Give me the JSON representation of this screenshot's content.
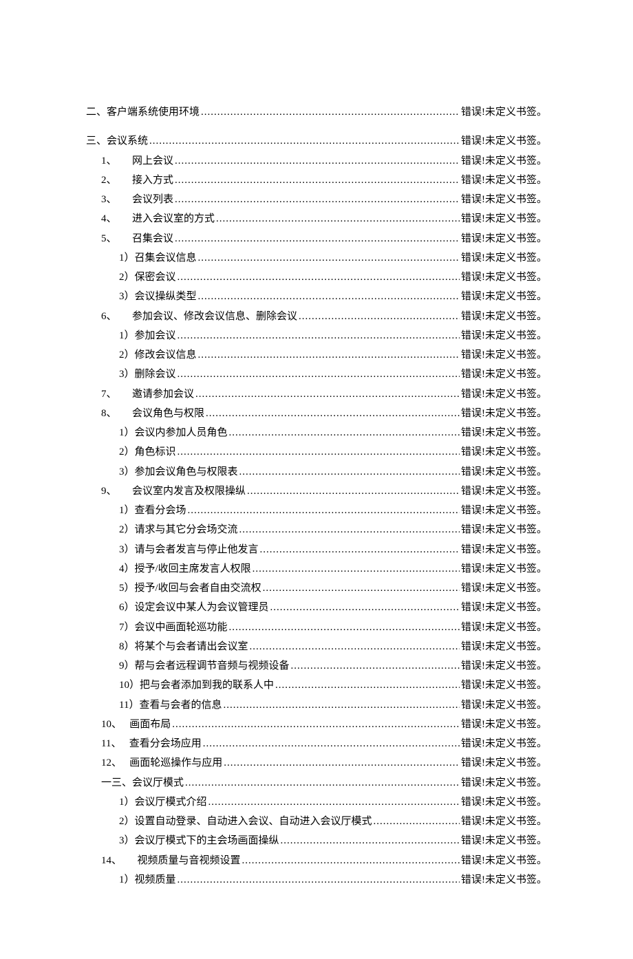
{
  "ref": "错误!未定义书签。",
  "toc": [
    {
      "label": "二、客户端系统使用环境",
      "indent": 0,
      "space": false
    },
    {
      "label": "三、会议系统",
      "indent": 0,
      "space": true
    },
    {
      "label": "1、　　网上会议 ",
      "indent": 1,
      "space": false
    },
    {
      "label": "2、　　接入方式 ",
      "indent": 1,
      "space": false
    },
    {
      "label": "3、　　会议列表 ",
      "indent": 1,
      "space": false
    },
    {
      "label": "4、　　进入会议室的方式 ",
      "indent": 1,
      "space": false
    },
    {
      "label": "5、　　召集会议 ",
      "indent": 1,
      "space": false
    },
    {
      "label": "1）召集会议信息",
      "indent": 2,
      "space": false
    },
    {
      "label": "2）保密会议",
      "indent": 2,
      "space": false
    },
    {
      "label": "3）会议操纵类型",
      "indent": 2,
      "space": false
    },
    {
      "label": "6、　　参加会议、修改会议信息、删除会议 ",
      "indent": 1,
      "space": false
    },
    {
      "label": "1）参加会议",
      "indent": 2,
      "space": false
    },
    {
      "label": "2）修改会议信息",
      "indent": 2,
      "space": false
    },
    {
      "label": "3）删除会议",
      "indent": 2,
      "space": false
    },
    {
      "label": "7、　　邀请参加会议 ",
      "indent": 1,
      "space": false
    },
    {
      "label": "8、　　会议角色与权限 ",
      "indent": 1,
      "space": false
    },
    {
      "label": "1）会议内参加人员角色",
      "indent": 2,
      "space": false
    },
    {
      "label": "2）角色标识",
      "indent": 2,
      "space": false
    },
    {
      "label": "3）参加会议角色与权限表",
      "indent": 2,
      "space": false
    },
    {
      "label": "9、　　会议室内发言及权限操纵 ",
      "indent": 1,
      "space": false
    },
    {
      "label": "1）查看分会场",
      "indent": 2,
      "space": false
    },
    {
      "label": "2）请求与其它分会场交流",
      "indent": 2,
      "space": false
    },
    {
      "label": "3）请与会者发言与停止他发言",
      "indent": 2,
      "space": false
    },
    {
      "label": "4）授予/收回主席发言人权限",
      "indent": 2,
      "space": false
    },
    {
      "label": "5）授予/收回与会者自由交流权",
      "indent": 2,
      "space": false
    },
    {
      "label": "6）设定会议中某人为会议管理员",
      "indent": 2,
      "space": false
    },
    {
      "label": "7）会议中画面轮巡功能",
      "indent": 2,
      "space": false
    },
    {
      "label": "8）将某个与会者请出会议室",
      "indent": 2,
      "space": false
    },
    {
      "label": "9）帮与会者远程调节音频与视频设备",
      "indent": 2,
      "space": false
    },
    {
      "label": "10）把与会者添加到我的联系人中",
      "indent": 2,
      "space": false
    },
    {
      "label": "11）查看与会者的信息",
      "indent": 2,
      "space": false
    },
    {
      "label": "10、　 画面布局 ",
      "indent": 1,
      "space": false
    },
    {
      "label": "11、　 查看分会场应用 ",
      "indent": 1,
      "space": false
    },
    {
      "label": "12、　 画面轮巡操作与应用 ",
      "indent": 1,
      "space": false
    },
    {
      "label": "一三、会议厅模式",
      "indent": 1,
      "space": false
    },
    {
      "label": "1）会议厅模式介绍",
      "indent": 2,
      "space": false
    },
    {
      "label": "2）设置自动登录、自动进入会议、自动进入会议厅模式",
      "indent": 2,
      "space": false
    },
    {
      "label": "3）会议厅模式下的主会场画面操纵",
      "indent": 2,
      "space": false
    },
    {
      "label": "14、　　视频质量与音视频设置 ",
      "indent": 1,
      "space": false
    },
    {
      "label": "1）视频质量",
      "indent": 2,
      "space": false
    }
  ]
}
